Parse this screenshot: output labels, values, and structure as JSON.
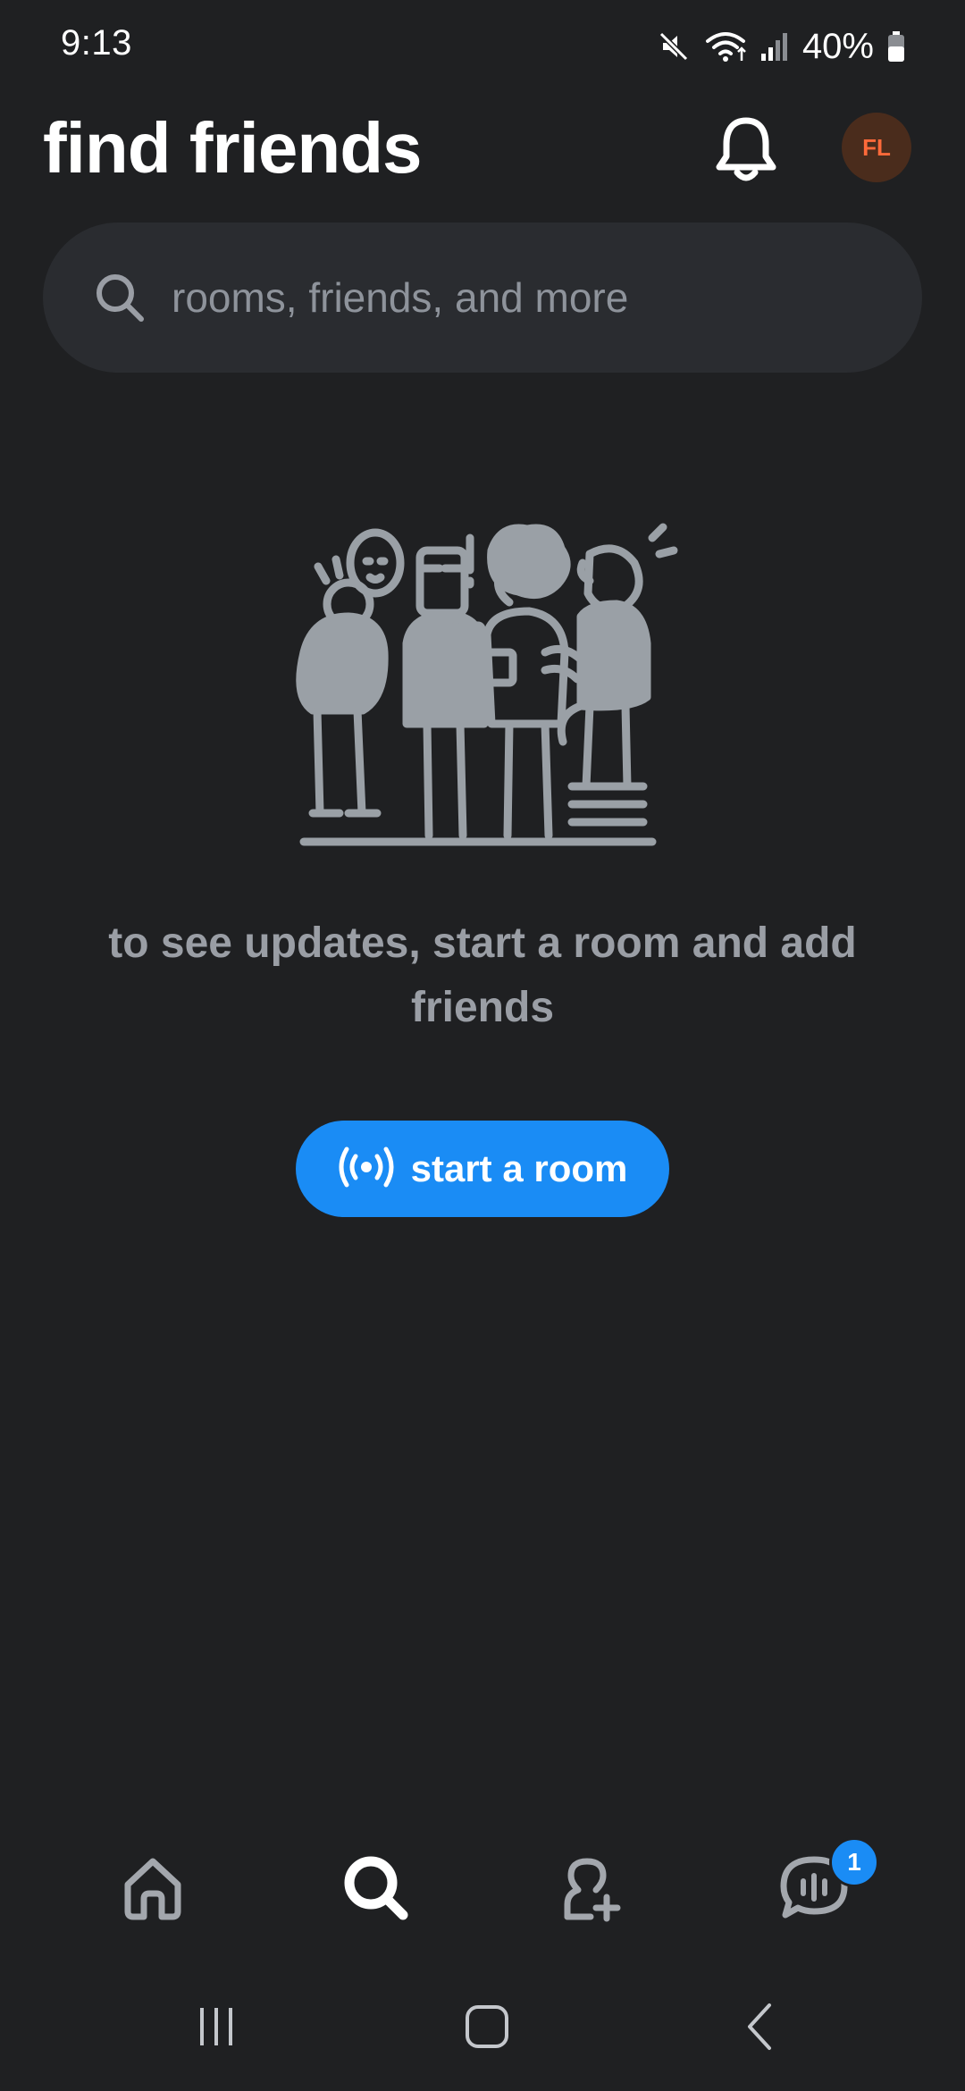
{
  "status_bar": {
    "time": "9:13",
    "battery": "40%",
    "icons": [
      "mute-icon",
      "wifi-icon",
      "signal-icon",
      "battery-icon"
    ]
  },
  "header": {
    "title": "find friends",
    "bell_icon": "bell-icon",
    "avatar_initials": "FL"
  },
  "search": {
    "placeholder": "rooms, friends, and more",
    "value": ""
  },
  "empty_state": {
    "illustration": "group-of-friends-illustration",
    "message": "to see updates, start a room and add friends"
  },
  "start_room": {
    "label": "start a room",
    "icon": "broadcast-icon"
  },
  "bottom_nav": {
    "items": [
      {
        "name": "home",
        "icon": "home-icon",
        "active": false
      },
      {
        "name": "search",
        "icon": "search-icon",
        "active": true
      },
      {
        "name": "add-friend",
        "icon": "add-friend-icon",
        "active": false
      },
      {
        "name": "chat",
        "icon": "chat-icon",
        "active": false
      }
    ],
    "chat_badge": "1"
  },
  "system_nav": [
    "recents",
    "home",
    "back"
  ],
  "colors": {
    "background": "#1f2022",
    "accent": "#1a8cf5",
    "avatar_bg": "#4a2c1c",
    "avatar_text": "#ff6a3a",
    "muted_text": "#9a9ea5"
  }
}
